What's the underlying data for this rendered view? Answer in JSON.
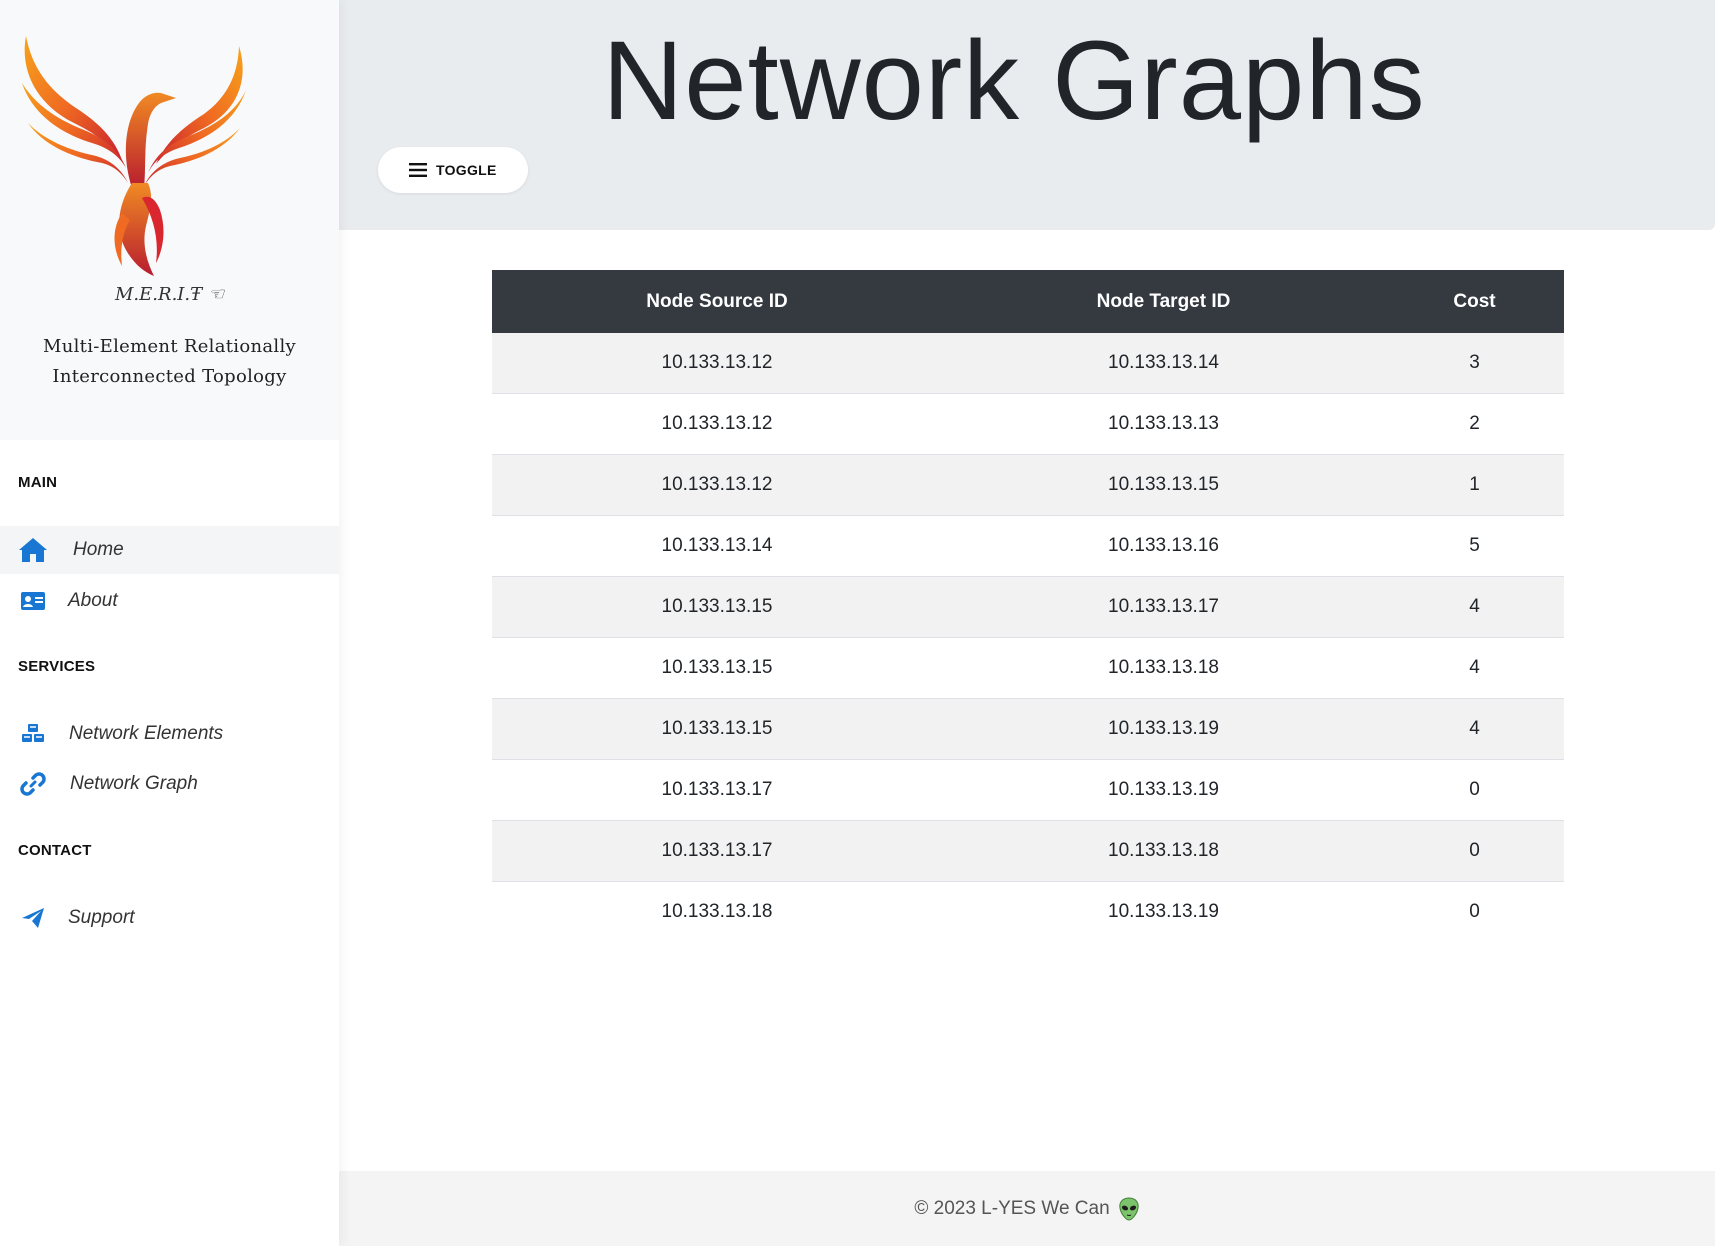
{
  "sidebar": {
    "brand_acronym": "M.E.R.I.Ŧ ☜",
    "brand_full_line1": "Multi-Element Relationally",
    "brand_full_line2": "Interconnected Topology",
    "sections": {
      "main": "MAIN",
      "services": "SERVICES",
      "contact": "CONTACT"
    },
    "items": {
      "home": {
        "label": "Home",
        "icon": "home-icon"
      },
      "about": {
        "label": "About",
        "icon": "id-card-icon"
      },
      "network_elements": {
        "label": "Network Elements",
        "icon": "cubes-icon"
      },
      "network_graph": {
        "label": "Network Graph",
        "icon": "link-icon"
      },
      "support": {
        "label": "Support",
        "icon": "paper-plane-icon"
      }
    },
    "accent_color": "#1976d2"
  },
  "header": {
    "title": "Network Graphs",
    "toggle_label": "TOGGLE"
  },
  "table": {
    "columns": [
      "Node Source ID",
      "Node Target ID",
      "Cost"
    ],
    "rows": [
      [
        "10.133.13.12",
        "10.133.13.14",
        "3"
      ],
      [
        "10.133.13.12",
        "10.133.13.13",
        "2"
      ],
      [
        "10.133.13.12",
        "10.133.13.15",
        "1"
      ],
      [
        "10.133.13.14",
        "10.133.13.16",
        "5"
      ],
      [
        "10.133.13.15",
        "10.133.13.17",
        "4"
      ],
      [
        "10.133.13.15",
        "10.133.13.18",
        "4"
      ],
      [
        "10.133.13.15",
        "10.133.13.19",
        "4"
      ],
      [
        "10.133.13.17",
        "10.133.13.19",
        "0"
      ],
      [
        "10.133.13.17",
        "10.133.13.18",
        "0"
      ],
      [
        "10.133.13.18",
        "10.133.13.19",
        "0"
      ]
    ]
  },
  "footer": {
    "text": "© 2023 L-YES We Can",
    "icon": "alien-icon"
  }
}
